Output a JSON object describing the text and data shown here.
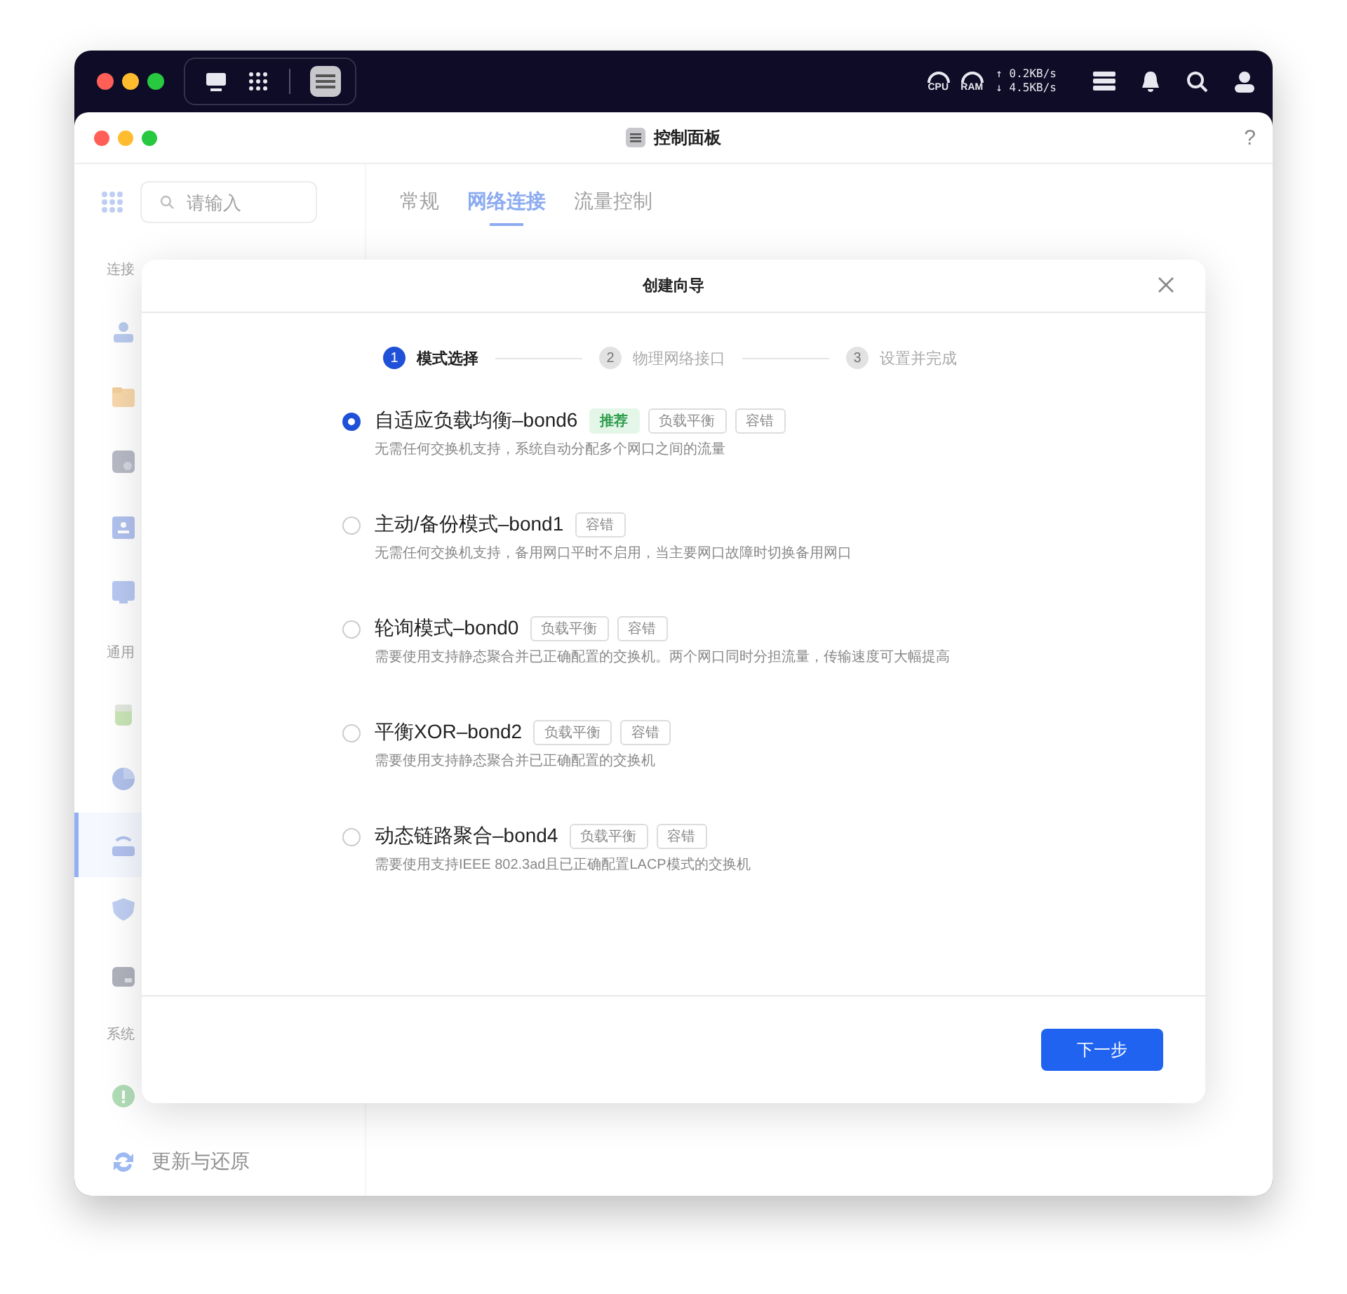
{
  "top_bar": {
    "gauges": [
      {
        "label": "CPU"
      },
      {
        "label": "RAM"
      }
    ],
    "network": {
      "upload": "↑ 0.2KB/s",
      "download": "↓ 4.5KB/s"
    }
  },
  "window": {
    "title": "控制面板",
    "help": "?"
  },
  "sidebar": {
    "search": {
      "placeholder": "请输入"
    },
    "sections": [
      {
        "label": "连接",
        "items": [
          {
            "selected": false
          },
          {
            "selected": false
          },
          {
            "selected": false
          },
          {
            "selected": false
          },
          {
            "selected": false
          }
        ]
      },
      {
        "label": "通用",
        "items": [
          {
            "selected": false
          },
          {
            "selected": false
          },
          {
            "selected": true
          },
          {
            "selected": false
          },
          {
            "selected": false
          }
        ]
      },
      {
        "label": "系统",
        "items": [
          {
            "selected": false
          },
          {
            "label": "更新与还原",
            "selected": false
          }
        ]
      }
    ]
  },
  "tabs": [
    {
      "label": "常规",
      "selected": false
    },
    {
      "label": "网络连接",
      "selected": true
    },
    {
      "label": "流量控制",
      "selected": false
    }
  ],
  "modal": {
    "title": "创建向导",
    "steps": [
      {
        "number": "1",
        "label": "模式选择",
        "active": true
      },
      {
        "number": "2",
        "label": "物理网络接口",
        "active": false
      },
      {
        "number": "3",
        "label": "设置并完成",
        "active": false
      }
    ],
    "options": [
      {
        "title": "自适应负载均衡–bond6",
        "selected": true,
        "tags": [
          {
            "text": "推荐",
            "kind": "recommend"
          },
          {
            "text": "负载平衡",
            "kind": "plain"
          },
          {
            "text": "容错",
            "kind": "plain"
          }
        ],
        "description": "无需任何交换机支持，系统自动分配多个网口之间的流量"
      },
      {
        "title": "主动/备份模式–bond1",
        "selected": false,
        "tags": [
          {
            "text": "容错",
            "kind": "plain"
          }
        ],
        "description": "无需任何交换机支持，备用网口平时不启用，当主要网口故障时切换备用网口"
      },
      {
        "title": "轮询模式–bond0",
        "selected": false,
        "tags": [
          {
            "text": "负载平衡",
            "kind": "plain"
          },
          {
            "text": "容错",
            "kind": "plain"
          }
        ],
        "description": "需要使用支持静态聚合并已正确配置的交换机。两个网口同时分担流量，传输速度可大幅提高"
      },
      {
        "title": "平衡XOR–bond2",
        "selected": false,
        "tags": [
          {
            "text": "负载平衡",
            "kind": "plain"
          },
          {
            "text": "容错",
            "kind": "plain"
          }
        ],
        "description": "需要使用支持静态聚合并已正确配置的交换机"
      },
      {
        "title": "动态链路聚合–bond4",
        "selected": false,
        "tags": [
          {
            "text": "负载平衡",
            "kind": "plain"
          },
          {
            "text": "容错",
            "kind": "plain"
          }
        ],
        "description": "需要使用支持IEEE 802.3ad且已正确配置LACP模式的交换机"
      }
    ],
    "next_button": "下一步"
  }
}
